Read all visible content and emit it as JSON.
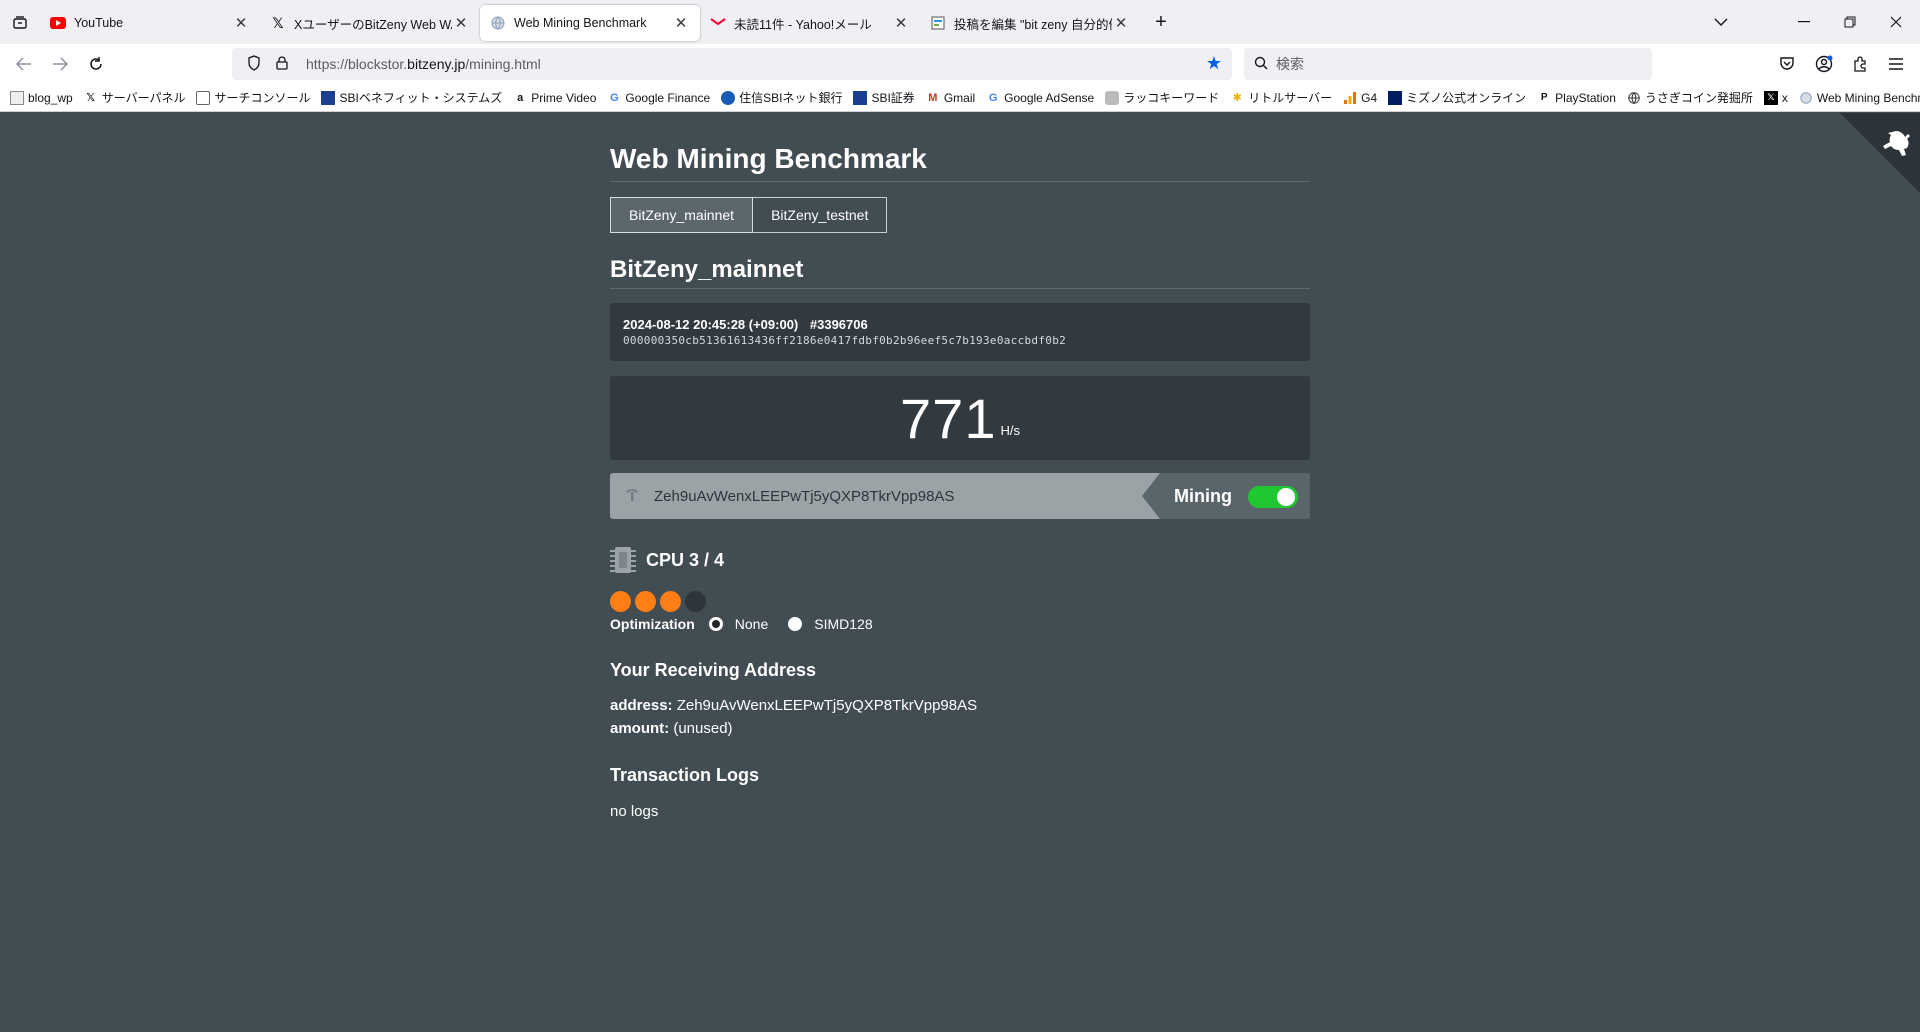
{
  "browser": {
    "tabs": [
      {
        "title": "YouTube",
        "active": false,
        "icon": "youtube-icon"
      },
      {
        "title": "XユーザーのBitZeny Web WALLET",
        "active": false,
        "icon": "x-icon"
      },
      {
        "title": "Web Mining Benchmark",
        "active": true,
        "icon": "globe-icon"
      },
      {
        "title": "未読11件 - Yahoo!メール",
        "active": false,
        "icon": "yahoo-mail-icon"
      },
      {
        "title": "投稿を編集 \"bit zeny 自分的備忘",
        "active": false,
        "icon": "wordpress-icon"
      }
    ],
    "url_prefix": "https://blockstor.",
    "url_domain": "bitzeny.jp",
    "url_path": "/mining.html",
    "search_placeholder": "検索",
    "bookmarks": [
      {
        "label": "blog_wp",
        "icon": "page-icon"
      },
      {
        "label": "サーバーパネル",
        "icon": "x-icon"
      },
      {
        "label": "サーチコンソール",
        "icon": "console-icon"
      },
      {
        "label": "SBIベネフィット・システムズ",
        "icon": "sbi-icon"
      },
      {
        "label": "Prime Video",
        "icon": "amazon-icon"
      },
      {
        "label": "Google Finance",
        "icon": "google-icon"
      },
      {
        "label": "住信SBIネット銀行",
        "icon": "bank-icon"
      },
      {
        "label": "SBI証券",
        "icon": "sbi-icon"
      },
      {
        "label": "Gmail",
        "icon": "gmail-icon"
      },
      {
        "label": "Google AdSense",
        "icon": "google-icon"
      },
      {
        "label": "ラッコキーワード",
        "icon": "rakko-icon"
      },
      {
        "label": "リトルサーバー",
        "icon": "server-icon"
      },
      {
        "label": "G4",
        "icon": "analytics-icon"
      },
      {
        "label": "ミズノ公式オンライン",
        "icon": "mizuno-icon"
      },
      {
        "label": "PlayStation",
        "icon": "playstation-icon"
      },
      {
        "label": "うさぎコイン発掘所",
        "icon": "globe-icon"
      },
      {
        "label": "x",
        "icon": "x-icon"
      },
      {
        "label": "Web Mining Benchmark",
        "icon": "globe-icon"
      }
    ]
  },
  "page": {
    "title": "Web Mining Benchmark",
    "network_tabs": [
      {
        "label": "BitZeny_mainnet",
        "selected": true
      },
      {
        "label": "BitZeny_testnet",
        "selected": false
      }
    ],
    "network_heading": "BitZeny_mainnet",
    "block": {
      "datetime": "2024-08-12 20:45:28 (+09:00)",
      "height": "#3396706",
      "hash": "000000350cb51361613436ff2186e0417fdbf0b2b96eef5c7b193e0accbdf0b2"
    },
    "hashrate": {
      "value": "771",
      "unit": "H/s"
    },
    "mining": {
      "address": "Zeh9uAvWenxLEEPwTj5yQXP8TkrVpp98AS",
      "label": "Mining",
      "enabled": true
    },
    "cpu": {
      "label": "CPU 3 / 4",
      "used": 3,
      "total": 4
    },
    "optimization": {
      "label": "Optimization",
      "options": [
        {
          "label": "None",
          "selected": true
        },
        {
          "label": "SIMD128",
          "selected": false
        }
      ]
    },
    "receiving": {
      "heading": "Your Receiving Address",
      "address_key": "address:",
      "address_value": "Zeh9uAvWenxLEEPwTj5yQXP8TkrVpp98AS",
      "amount_key": "amount:",
      "amount_value": "(unused)"
    },
    "logs": {
      "heading": "Transaction Logs",
      "empty_text": "no logs"
    }
  },
  "colors": {
    "page_bg": "#424c53",
    "panel_bg": "#323a40",
    "accent_orange": "#ff7f16",
    "toggle_green": "#1fc830"
  }
}
